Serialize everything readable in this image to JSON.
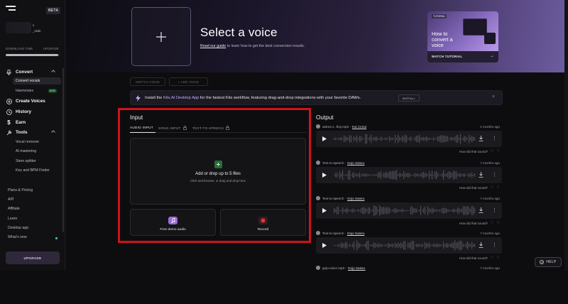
{
  "sidebar": {
    "beta": "BETA",
    "user_line1": "s",
    "user_line2": "_rade",
    "download_time": "DOWNLOAD TIME",
    "upgrade_link": "UPGRADE",
    "download_fraction": 0.98,
    "convert": "Convert",
    "convert_vocals": "Convert vocals",
    "harmonies": "Harmonies",
    "new_badge": "NEW",
    "create_voices": "Create Voices",
    "history": "History",
    "earn": "Earn",
    "tools": "Tools",
    "vocal_remover": "Vocal remover",
    "ai_mastering": "AI mastering",
    "stem_splitter": "Stem splitter",
    "key_bpm": "Key and BPM Finder",
    "plans": "Plans & Pricing",
    "api": "API",
    "affiliate": "Affiliate",
    "learn": "Learn",
    "desktop_app": "Desktop app",
    "whats_new": "What's new",
    "upgrade_button": "UPGRADE"
  },
  "banner": {
    "title": "Select a voice",
    "guide_link": "Read our guide",
    "guide_rest": " to learn how to get the best conversion results.",
    "tutorial_tag": "TUTORIAL",
    "tutorial_heading": "How to convert a voice",
    "tutorial_label": "WATCH TUTORIAL"
  },
  "actions": {
    "switch_voice": "SWITCH VOICE",
    "add_voice": "+ ADD VOICE"
  },
  "install": {
    "pre": "Install the ",
    "app": "Kits.AI Desktop App",
    "post": " for the fastest Kits workflow, featuring drag-and-drop integrations with your favorite DAWs.",
    "button": "INSTALL"
  },
  "input": {
    "title": "Input",
    "tabs": [
      "AUDIO INPUT",
      "SONG INPUT",
      "TEXT-TO-SPEECH"
    ],
    "drop_title": "Add or drop up to 5 files",
    "drop_sub": "Click and browse, or drag and drop here",
    "demo": "Free demo audio",
    "record": "Record"
  },
  "output": {
    "title": "Output",
    "feedback": "How did that sound?",
    "items": [
      {
        "name": "astros-v...ftny.mp3 - ",
        "voice": "Kai Cenat",
        "ago": "4 months ago"
      },
      {
        "name": "Text-to-speech - ",
        "voice": "Gojo Satoru",
        "ago": "7 months ago"
      },
      {
        "name": "Text-to-speech - ",
        "voice": "Gojo Satoru",
        "ago": "7 months ago"
      },
      {
        "name": "Text-to-speech - ",
        "voice": "Gojo Satoru",
        "ago": "7 months ago"
      },
      {
        "name": "gojo-voice.mp3 - ",
        "voice": "Gojo Satoru",
        "ago": "7 months ago"
      }
    ]
  },
  "help": "HELP",
  "colors": {
    "accent": "#c4a9ff",
    "highlight_box": "#d11219",
    "new_badge": "#6fe089"
  }
}
